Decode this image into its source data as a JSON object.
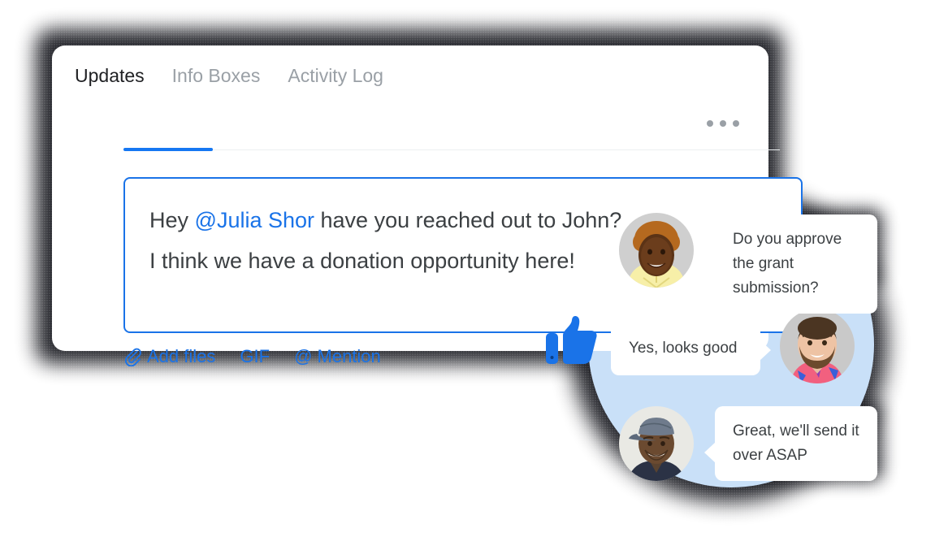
{
  "card": {
    "tabs": [
      {
        "label": "Updates",
        "active": true
      },
      {
        "label": "Info Boxes",
        "active": false
      },
      {
        "label": "Activity Log",
        "active": false
      }
    ],
    "more_menu_name": "more-options",
    "composer": {
      "line1_prefix": "Hey ",
      "mention": "@Julia Shor",
      "line1_suffix": " have you reached out to John?",
      "line2": "I think we have a donation opportunity here!"
    },
    "toolbar": {
      "add_files": "Add files",
      "gif": "GIF",
      "mention": "@ Mention"
    }
  },
  "reactions": {
    "thumbs_up": "thumbs-up"
  },
  "chat": {
    "messages": [
      {
        "text": "Do you approve the grant submission?",
        "side": "left",
        "avatar": "woman-curly-hair-yellow-top"
      },
      {
        "text": "Yes, looks good",
        "side": "right",
        "avatar": "bearded-man-pink-shirt"
      },
      {
        "text": "Great, we'll send it over ASAP",
        "side": "left",
        "avatar": "man-gray-cap-navy-shirt"
      }
    ]
  },
  "colors": {
    "accent_blue": "#1a73e8",
    "tab_underline": "#1677f2",
    "circle_blue": "#c9e0f8",
    "text_dark": "#3c4043",
    "text_muted": "#9aa0a6",
    "card_white": "#ffffff"
  }
}
